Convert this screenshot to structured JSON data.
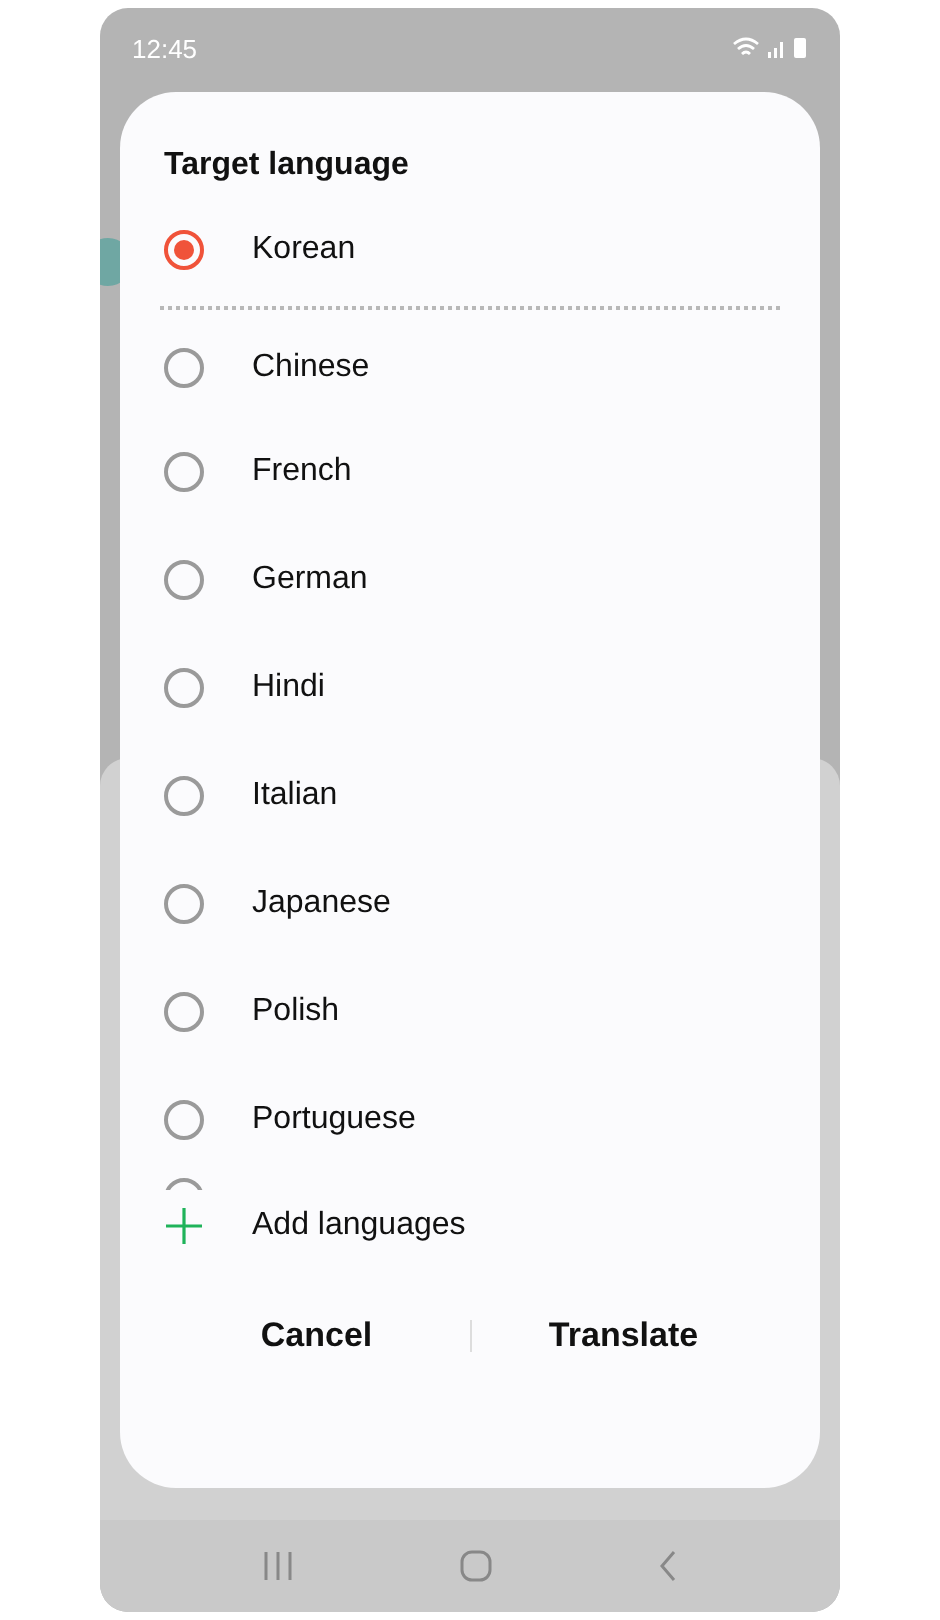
{
  "status_bar": {
    "time": "12:45"
  },
  "dialog": {
    "title": "Target language",
    "current": {
      "label": "Korean",
      "selected": true
    },
    "languages": [
      {
        "label": "Chinese",
        "selected": false
      },
      {
        "label": "French",
        "selected": false
      },
      {
        "label": "German",
        "selected": false
      },
      {
        "label": "Hindi",
        "selected": false
      },
      {
        "label": "Italian",
        "selected": false
      },
      {
        "label": "Japanese",
        "selected": false
      },
      {
        "label": "Polish",
        "selected": false
      },
      {
        "label": "Portuguese",
        "selected": false
      }
    ],
    "add_label": "Add languages",
    "buttons": [
      "Cancel",
      "Translate"
    ]
  }
}
